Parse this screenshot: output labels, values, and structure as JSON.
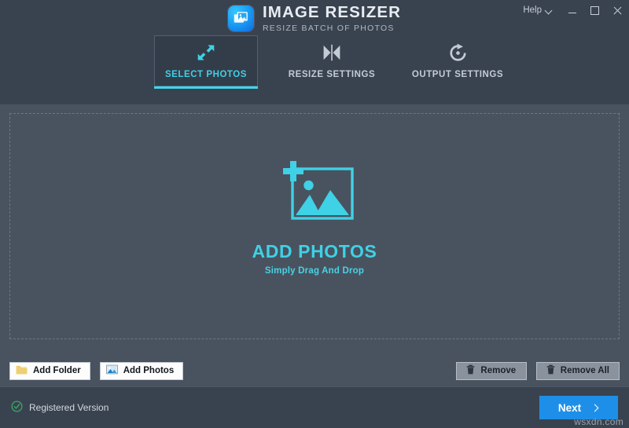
{
  "window": {
    "help_label": "Help",
    "minimize_label": "Minimize",
    "maximize_label": "Maximize",
    "close_label": "Close"
  },
  "brand": {
    "title": "IMAGE RESIZER",
    "subtitle": "RESIZE BATCH OF PHOTOS",
    "logo_icon": "image-logo-icon",
    "accent": "#3fd1e6"
  },
  "tabs": [
    {
      "label": "SELECT PHOTOS",
      "icon": "resize-diagonal-arrows-icon",
      "active": true
    },
    {
      "label": "RESIZE SETTINGS",
      "icon": "collapse-horizontal-icon",
      "active": false
    },
    {
      "label": "OUTPUT SETTINGS",
      "icon": "rotate-refresh-icon",
      "active": false
    }
  ],
  "dropzone": {
    "icon": "add-photo-icon",
    "title": "ADD PHOTOS",
    "subtitle": "Simply Drag And Drop"
  },
  "actions": {
    "add_folder": {
      "label": "Add Folder",
      "icon": "folder-icon"
    },
    "add_photos": {
      "label": "Add Photos",
      "icon": "photo-icon"
    },
    "remove": {
      "label": "Remove",
      "icon": "trash-icon"
    },
    "remove_all": {
      "label": "Remove All",
      "icon": "trash-icon"
    }
  },
  "status": {
    "registration": "Registered Version",
    "registration_icon": "check-circle-icon",
    "next_label": "Next",
    "next_icon": "chevron-right-icon",
    "watermark": "wsxdn.com"
  }
}
